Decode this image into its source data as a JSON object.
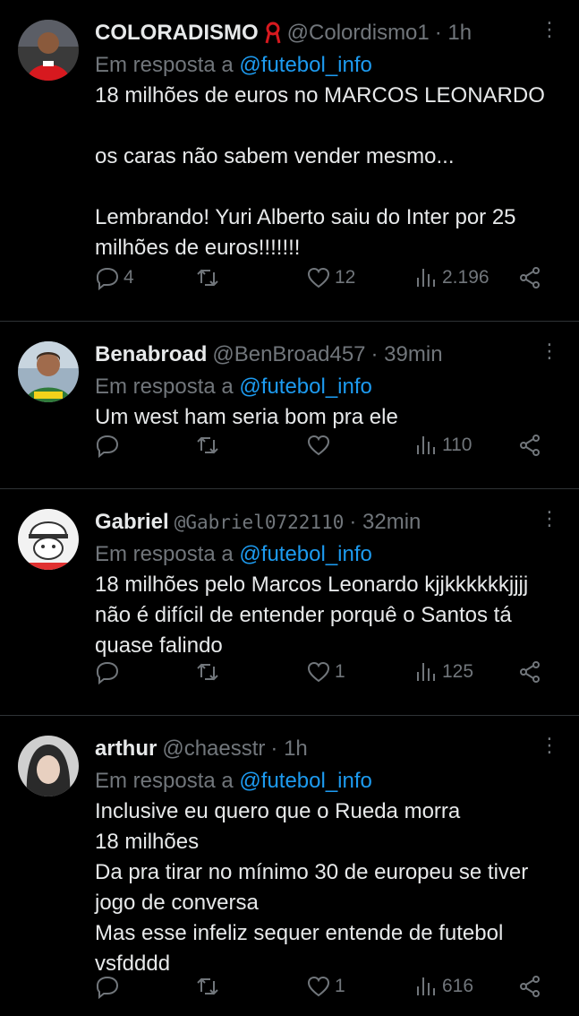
{
  "tweets": [
    {
      "name": "COLORADISMO",
      "handle": "@Colordismo1",
      "time": "· 1h",
      "reply_label": "Em resposta a",
      "mention": "@futebol_info",
      "body": "18 milhões de euros no MARCOS LEONARDO\n\nos caras não sabem vender mesmo...\n\nLembrando! Yuri Alberto saiu do Inter por 25 milhões de euros!!!!!!!",
      "replies": "4",
      "retweets": "",
      "likes": "12",
      "views": "2.196"
    },
    {
      "name": "Benabroad",
      "handle": "@BenBroad457",
      "time": "· 39min",
      "reply_label": "Em resposta a",
      "mention": "@futebol_info",
      "body": "Um west ham seria bom pra ele",
      "replies": "",
      "retweets": "",
      "likes": "",
      "views": "110"
    },
    {
      "name": "Gabriel",
      "handle": "@Gabriel0722110",
      "time": "· 32min",
      "reply_label": "Em resposta a",
      "mention": "@futebol_info",
      "body": "18 milhões pelo Marcos Leonardo kjjkkkkkkjjjj não é difícil de entender porquê o Santos tá quase falindo",
      "replies": "",
      "retweets": "",
      "likes": "1",
      "views": "125"
    },
    {
      "name": "arthur",
      "handle": "@chaesstr",
      "time": "· 1h",
      "reply_label": "Em resposta a",
      "mention": "@futebol_info",
      "body": "Inclusive eu quero que o Rueda morra\n18 milhões\nDa pra tirar no mínimo 30 de europeu se tiver jogo de conversa\nMas esse infeliz sequer entende de futebol vsfdddd",
      "replies": "",
      "retweets": "",
      "likes": "1",
      "views": "616"
    }
  ],
  "icons": {
    "more": "more-vertical-icon",
    "reply": "reply-icon",
    "retweet": "retweet-icon",
    "like": "heart-icon",
    "views": "views-icon",
    "share": "share-icon"
  },
  "colors": {
    "background": "#000000",
    "text": "#e7e9ea",
    "muted": "#71767b",
    "link": "#1d9bf0",
    "divider": "#2f3336"
  }
}
